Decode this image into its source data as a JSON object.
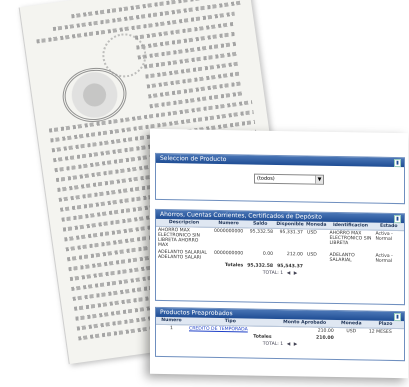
{
  "product_selection": {
    "title": "Seleccion de Producto",
    "selected_option": "(todos)"
  },
  "accounts": {
    "title": "Ahorros, Cuentas Corrientes, Certificados de Depósito",
    "columns": [
      "Descripcion",
      "Numero",
      "Saldo",
      "Disponible",
      "Moneda",
      "Identificacion",
      "Estado"
    ],
    "rows": [
      {
        "descripcion": "AHORRO MAX ELECTRONICO SIN LIBRETA AHORRO MAX",
        "numero": "0000000000",
        "saldo": "95,332.58",
        "disponible": "95,331.37",
        "moneda": "USD",
        "identificacion": "AHORRO MAX ELECTRONICO SIN LIBRETA",
        "estado": "Activa - Normal"
      },
      {
        "descripcion": "ADELANTO SALARIAL ADELANTO SALARI",
        "numero": "0000000000",
        "saldo": "0.00",
        "disponible": "212.00",
        "moneda": "USD",
        "identificacion": "ADELANTO SALARIAL",
        "estado": "Activa - Normal"
      }
    ],
    "totals_label": "Totales",
    "total_saldo": "95,332.58",
    "total_disponible": "95,543.37",
    "pager": "TOTAL: 1"
  },
  "preapproved": {
    "title": "Productos Preaprobados",
    "columns": [
      "Numero",
      "Tipo",
      "Monto Aprobado",
      "Moneda",
      "Plazo"
    ],
    "rows": [
      {
        "numero": "1",
        "tipo": "CREDITO DE TEMPORADA",
        "monto": "210.00",
        "moneda": "USD",
        "plazo": "12 MESES"
      }
    ],
    "totals_label": "Totales",
    "total_monto": "210.00",
    "pager": "TOTAL: 1"
  },
  "icons": {
    "panel_icon": "document-icon",
    "dropdown": "chevron-down-icon",
    "pager_prev": "prev-arrow-icon",
    "pager_next": "next-arrow-icon"
  },
  "colors": {
    "panel_header": "#1f4d94",
    "table_header_bg": "#dfe7f2",
    "link": "#1d3fc7"
  }
}
